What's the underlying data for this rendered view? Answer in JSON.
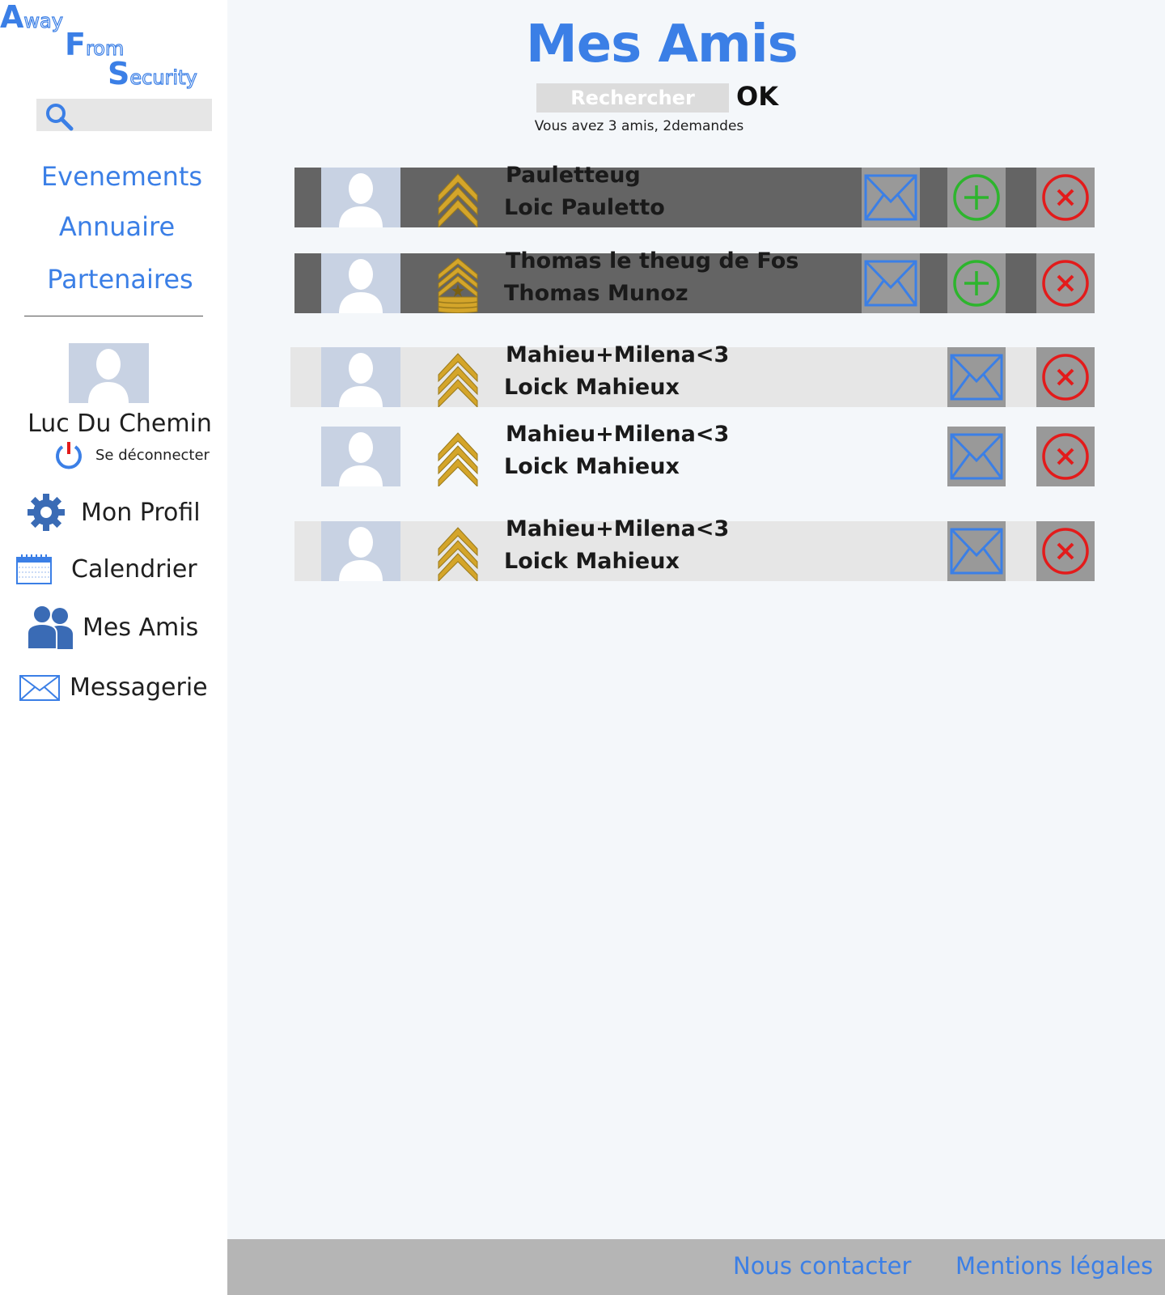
{
  "logo": {
    "line1_cap": "A",
    "line1_rest": "way",
    "line2_cap": "F",
    "line2_rest": "rom",
    "line3_cap": "S",
    "line3_rest": "ecurity"
  },
  "sidebar": {
    "search_placeholder": "",
    "nav": {
      "evenements": "Evenements",
      "annuaire": "Annuaire",
      "partenaires": "Partenaires"
    },
    "user": {
      "name": "Luc Du Chemin",
      "logout": "Se déconnecter"
    },
    "menu": {
      "profil": "Mon Profil",
      "calendrier": "Calendrier",
      "amis": "Mes Amis",
      "messagerie": "Messagerie"
    }
  },
  "main": {
    "title": "Mes Amis",
    "search_placeholder": "Rechercher",
    "ok_label": "OK",
    "summary": "Vous avez 3 amis, 2demandes",
    "friends": [
      {
        "pseudo": "Pauletteug",
        "name": "Loic Pauletto",
        "status": "request",
        "rank": "sergeant"
      },
      {
        "pseudo": "Thomas le theug de Fos",
        "name": "Thomas Munoz",
        "status": "request",
        "rank": "sergeant-major"
      },
      {
        "pseudo": "Mahieu+Milena<3",
        "name": "Loick Mahieux",
        "status": "friend",
        "rank": "sergeant"
      },
      {
        "pseudo": "Mahieu+Milena<3",
        "name": "Loick Mahieux",
        "status": "friend",
        "rank": "sergeant"
      },
      {
        "pseudo": "Mahieu+Milena<3",
        "name": "Loick Mahieux",
        "status": "friend",
        "rank": "sergeant"
      }
    ]
  },
  "footer": {
    "contact": "Nous contacter",
    "legal": "Mentions légales"
  },
  "colors": {
    "accent": "#3b7fe6",
    "accept": "#2db52d",
    "reject": "#e31b1b",
    "rank_gold": "#d4a52a"
  },
  "icons": [
    "search-icon",
    "power-icon",
    "gear-icon",
    "calendar-icon",
    "users-icon",
    "envelope-icon",
    "plus-circle-icon",
    "close-circle-icon",
    "chevron-rank-icon"
  ]
}
